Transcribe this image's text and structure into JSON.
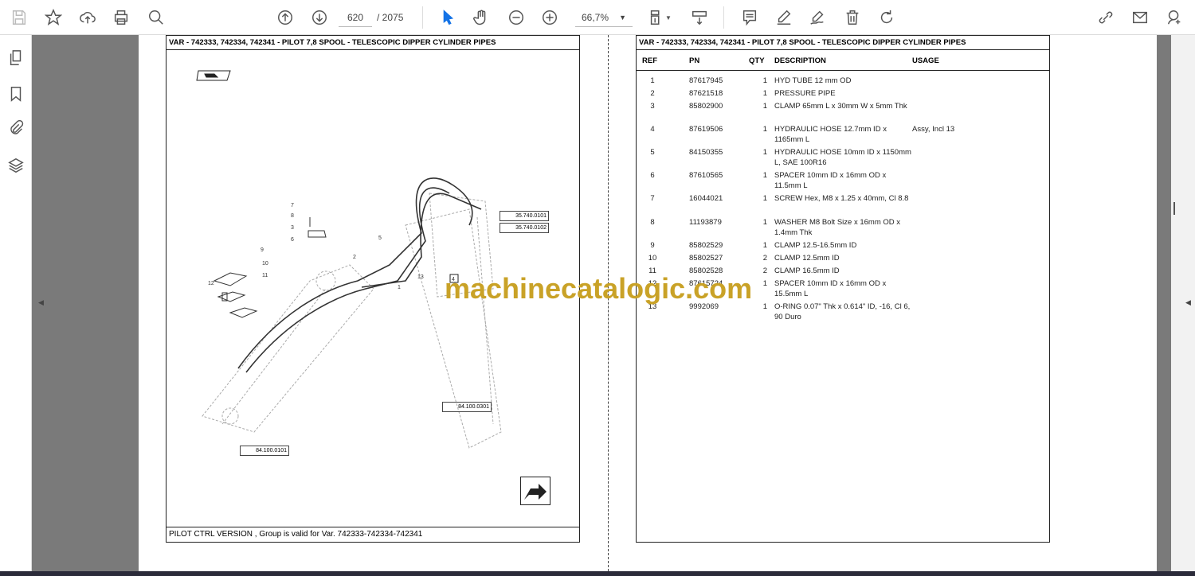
{
  "toolbar": {
    "current_page": "620",
    "total_pages": "/ 2075",
    "zoom": "66,7%",
    "icons": [
      "save-icon",
      "bookmark-star-icon",
      "upload-cloud-icon",
      "print-icon",
      "zoom-search-icon",
      "page-up-icon",
      "page-down-icon",
      "select-cursor-icon",
      "hand-tool-icon",
      "zoom-out-icon",
      "zoom-in-icon",
      "page-fit-icon",
      "scroll-mode-icon",
      "comment-icon",
      "highlight-icon",
      "sign-icon",
      "delete-icon",
      "rotate-icon",
      "link-share-icon",
      "email-icon",
      "add-user-icon"
    ],
    "accent": "#1473e6"
  },
  "left_nav": [
    "pages-icon",
    "bookmark-icon",
    "attachment-icon",
    "layers-icon"
  ],
  "left_page": {
    "title": "VAR - 742333, 742334, 742341 - PILOT 7,8 SPOOL - TELESCOPIC DIPPER CYLINDER PIPES",
    "footer": "PILOT CTRL VERSION , Group is valid for Var. 742333-742334-742341",
    "refs": {
      "r1": "35.740.0101",
      "r2": "35.740.0102",
      "r3": "84.100.0301",
      "r4": "84.100.0101"
    },
    "callouts": [
      "1",
      "2",
      "3",
      "4",
      "5",
      "6",
      "7",
      "8",
      "9",
      "10",
      "11",
      "12",
      "13"
    ]
  },
  "right_page": {
    "title": "VAR - 742333, 742334, 742341 - PILOT 7,8 SPOOL - TELESCOPIC DIPPER CYLINDER PIPES",
    "headers": {
      "ref": "REF",
      "pn": "PN",
      "qty": "QTY",
      "desc": "DESCRIPTION",
      "usage": "USAGE"
    },
    "rows": [
      {
        "ref": "1",
        "pn": "87617945",
        "qty": "1",
        "desc": "HYD TUBE 12 mm OD",
        "usage": ""
      },
      {
        "ref": "2",
        "pn": "87621518",
        "qty": "1",
        "desc": "PRESSURE PIPE",
        "usage": ""
      },
      {
        "ref": "3",
        "pn": "85802900",
        "qty": "1",
        "desc": "CLAMP 65mm L x 30mm W x 5mm Thk",
        "usage": ""
      },
      {
        "ref": "4",
        "pn": "87619506",
        "qty": "1",
        "desc": "HYDRAULIC HOSE 12.7mm ID x 1165mm L",
        "usage": "Assy, Incl 13"
      },
      {
        "ref": "5",
        "pn": "84150355",
        "qty": "1",
        "desc": "HYDRAULIC HOSE 10mm ID x 1150mm L, SAE 100R16",
        "usage": ""
      },
      {
        "ref": "6",
        "pn": "87610565",
        "qty": "1",
        "desc": "SPACER 10mm ID x 16mm OD x 11.5mm L",
        "usage": ""
      },
      {
        "ref": "7",
        "pn": "16044021",
        "qty": "1",
        "desc": "SCREW Hex, M8 x 1.25 x 40mm, Cl 8.8",
        "usage": ""
      },
      {
        "ref": "8",
        "pn": "11193879",
        "qty": "1",
        "desc": "WASHER M8 Bolt Size x 16mm OD x 1.4mm Thk",
        "usage": ""
      },
      {
        "ref": "9",
        "pn": "85802529",
        "qty": "1",
        "desc": "CLAMP 12.5-16.5mm ID",
        "usage": ""
      },
      {
        "ref": "10",
        "pn": "85802527",
        "qty": "2",
        "desc": "CLAMP 12.5mm ID",
        "usage": ""
      },
      {
        "ref": "11",
        "pn": "85802528",
        "qty": "2",
        "desc": "CLAMP 16.5mm ID",
        "usage": ""
      },
      {
        "ref": "12",
        "pn": "87615724",
        "qty": "1",
        "desc": "SPACER 10mm ID x 16mm OD x 15.5mm L",
        "usage": ""
      },
      {
        "ref": "13",
        "pn": "9992069",
        "qty": "1",
        "desc": "O-RING 0.07\" Thk x 0.614\" ID, -16, Cl 6, 90 Duro",
        "usage": ""
      }
    ]
  },
  "watermark": "machinecatalogic.com"
}
